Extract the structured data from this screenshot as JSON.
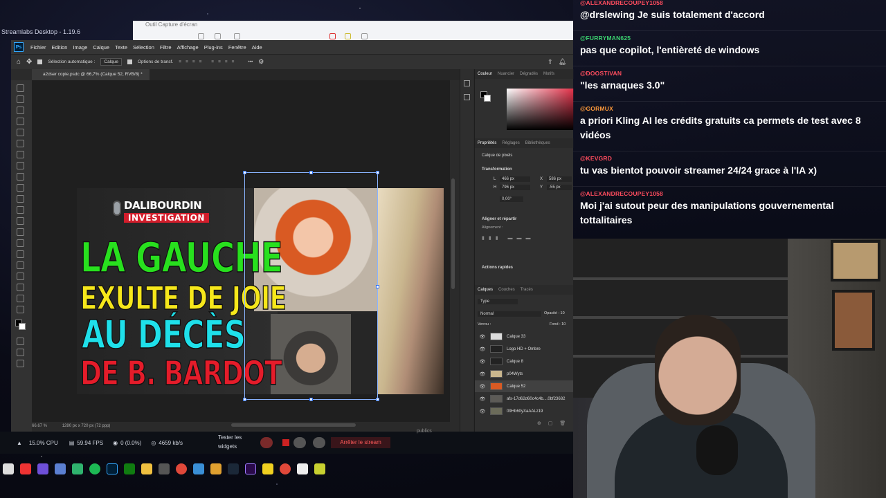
{
  "streamlabs": {
    "title": "Streamlabs Desktop - 1.19.6",
    "stats": {
      "cpu": "15.0% CPU",
      "fps": "59.94 FPS",
      "dropped": "0 (0.0%)",
      "bitrate": "4659 kb/s"
    },
    "test_widgets_line1": "Tester les",
    "test_widgets_line2": "widgets",
    "stop_stream": "Arrêter le stream"
  },
  "snip": {
    "title": "Outil Capture d'écran"
  },
  "photoshop": {
    "menus": [
      "Fichier",
      "Edition",
      "Image",
      "Calque",
      "Texte",
      "Sélection",
      "Filtre",
      "Affichage",
      "Plug-ins",
      "Fenêtre",
      "Aide"
    ],
    "options": {
      "auto_select": "Sélection automatique :",
      "auto_select_value": "Calque",
      "transform_options": "Options de transf."
    },
    "doc_tab": "a2dser copie.psdc @ 66,7% (Calque 52, RVB/8) *",
    "zoom": "66.67 %",
    "doc_size": "1280 px x 720 px (72 ppp)",
    "color_tabs": [
      "Couleur",
      "Nuancier",
      "Dégradés",
      "Motifs"
    ],
    "prop_tabs": [
      "Propriétés",
      "Réglages",
      "Bibliothèques"
    ],
    "prop_type": "Calque de pixels",
    "transformation": "Transformation",
    "fields": {
      "l_label": "L",
      "l_value": "466 px",
      "h_label": "H",
      "h_value": "796 px",
      "x_label": "X",
      "x_value": "586 px",
      "y_label": "Y",
      "y_value": "-55 px",
      "angle_value": "0,00°"
    },
    "align_section": "Aligner et répartir",
    "alignment_label": "Alignement :",
    "quick_actions": "Actions rapides",
    "layer_tabs": [
      "Calques",
      "Couches",
      "Tracés"
    ],
    "layer_filter": "Type",
    "blend_mode": "Normal",
    "opacity_label": "Opacité : 10",
    "lock_label": "Verrou :",
    "fill_label": "Fond : 10",
    "layers": [
      "Calque 33",
      "Logo HD + Ombre",
      "Calque 8",
      "p04Wyts",
      "Calque 52",
      "afs-17d62d60c4c4b....0bf23682",
      "09Hb60yXaAALz19"
    ],
    "selected_layer": "Calque 52"
  },
  "thumbnail": {
    "brand_top": "DALIBOURDIN",
    "brand_sub": "INVESTIGATION",
    "line1": "LA GAUCHE",
    "line2": "EXULTE DE JOIE",
    "line3": "AU DÉCÈS",
    "line4": "DE B. BARDOT",
    "colors": {
      "line1": "#28e01e",
      "line2": "#f6e71b",
      "line3": "#1fe0ea",
      "line4": "#e51c2a"
    }
  },
  "chat": {
    "messages": [
      {
        "user": "@ALEXANDRECOUPEY1058",
        "text": "@drslewing Je suis totalement d'accord",
        "color": "#ff4d5e"
      },
      {
        "user": "@FURRYMAN625",
        "text": "pas que copilot, l'entièreté de windows",
        "color": "#3bd16f"
      },
      {
        "user": "@DOOSTIVAN",
        "text": "\"les arnaques 3.0\"",
        "color": "#ff4d5e"
      },
      {
        "user": "@GORMUX",
        "text": "a priori Kling AI les crédits gratuits ca permets de test avec 8 vidéos",
        "color": "#ff9a3b"
      },
      {
        "user": "@KEVGRD",
        "text": "tu vas bientot pouvoir streamer 24/24 grace à l'IA x)",
        "color": "#ff4d5e"
      },
      {
        "user": "@ALEXANDRECOUPEY1058",
        "text": "Moi j'ai sutout peur des manipulations gouvernemental tottalitaires",
        "color": "#ff4d5e"
      }
    ]
  },
  "misc": {
    "publics": "publics"
  }
}
